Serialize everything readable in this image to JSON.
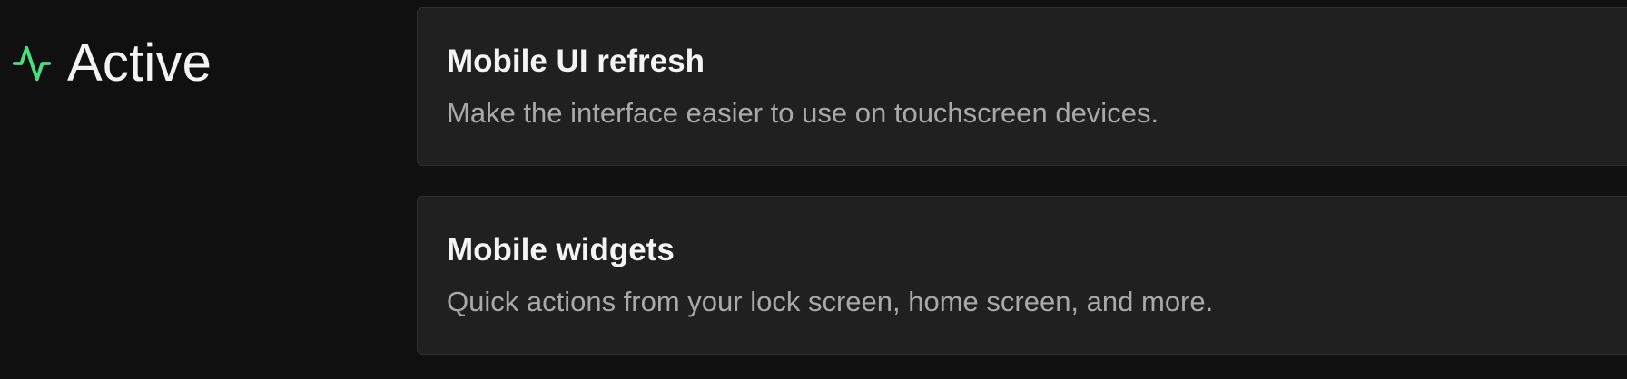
{
  "section": {
    "title": "Active",
    "icon": "activity-pulse-icon",
    "accent_color": "#4ade80"
  },
  "cards": [
    {
      "title": "Mobile UI refresh",
      "description": "Make the interface easier to use on touchscreen devices."
    },
    {
      "title": "Mobile widgets",
      "description": "Quick actions from your lock screen, home screen, and more."
    }
  ]
}
